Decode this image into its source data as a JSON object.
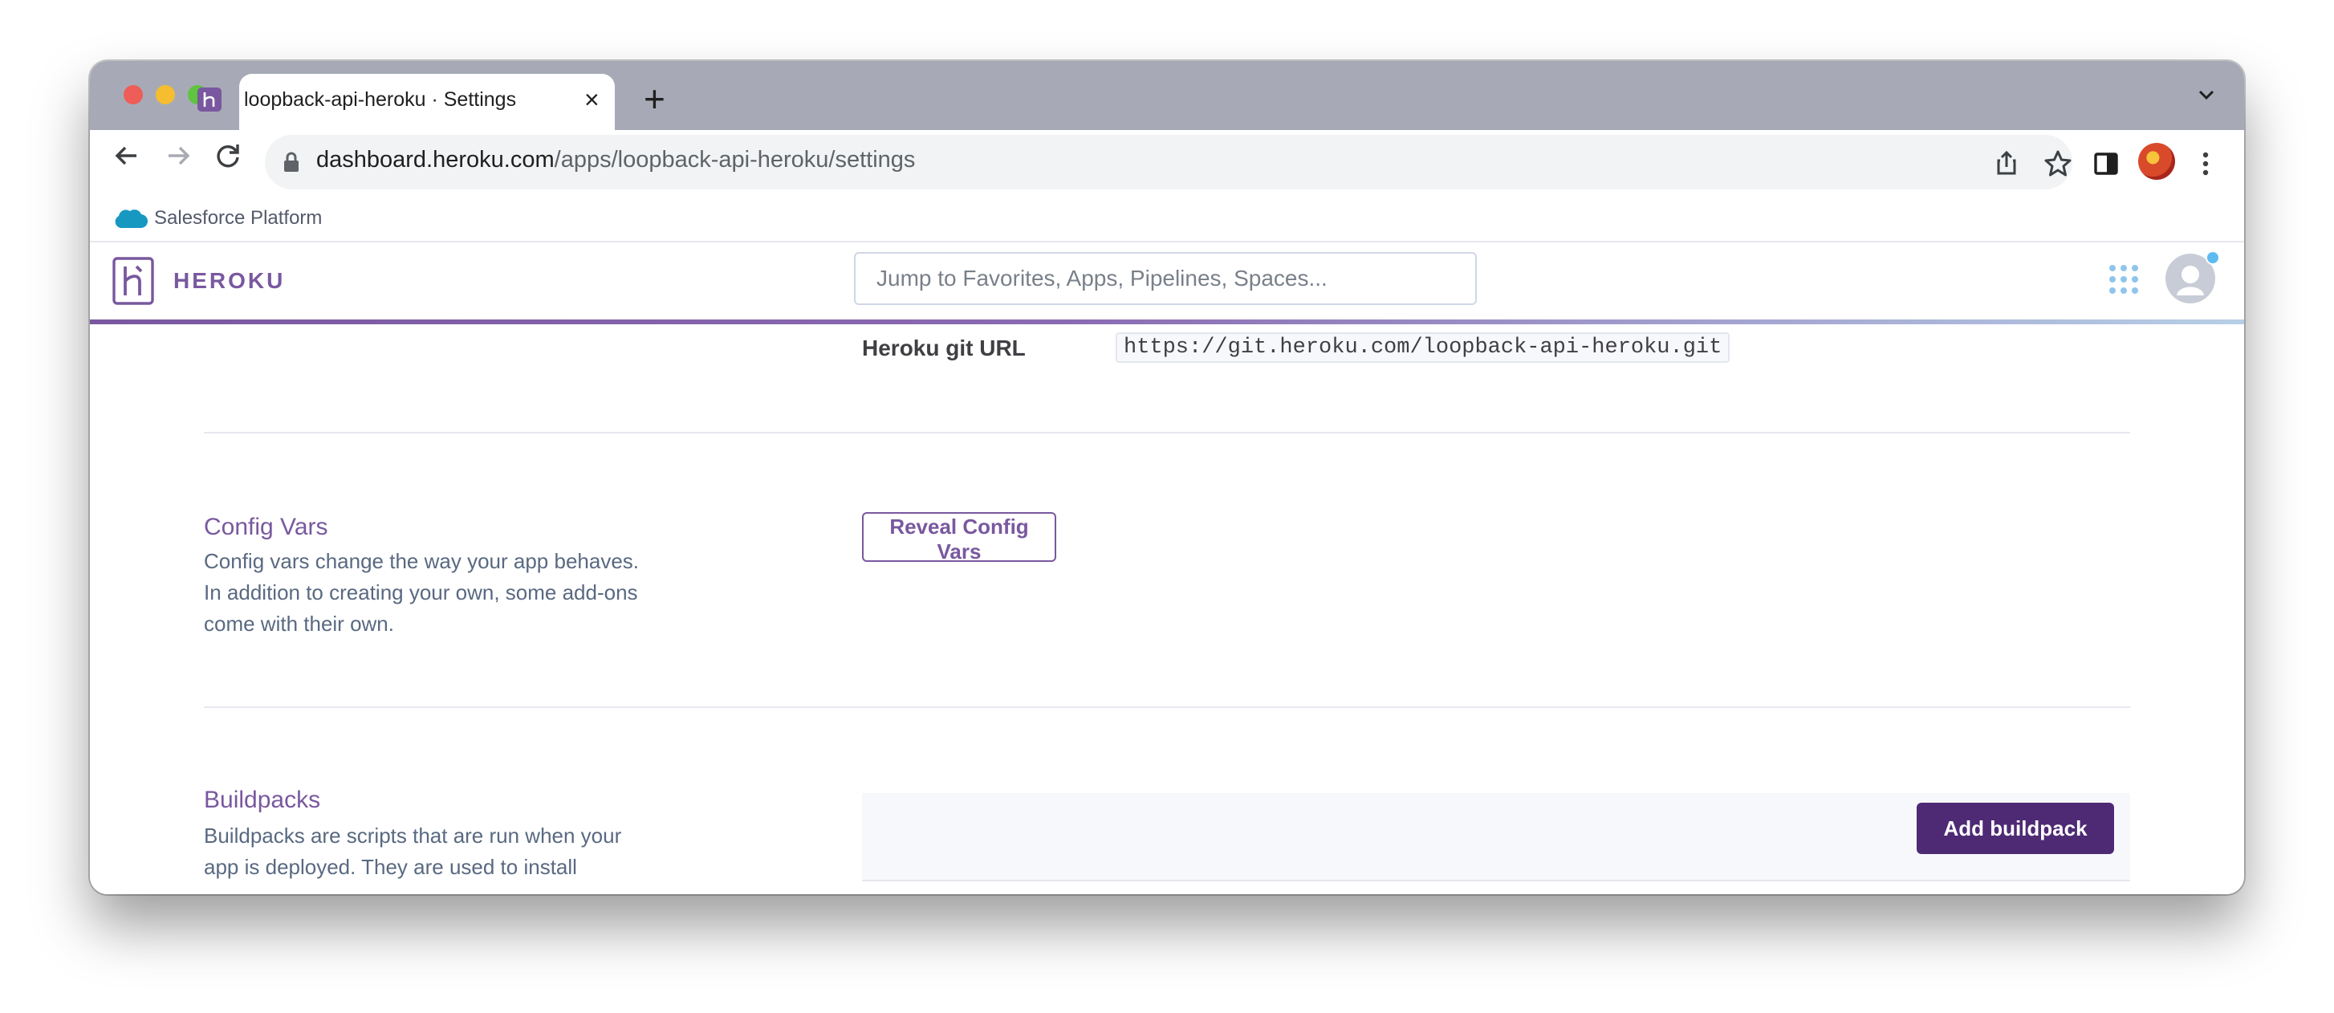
{
  "browser": {
    "tab": {
      "title": "loopback-api-heroku · Settings"
    },
    "new_tab_icon": "plus-icon",
    "url": {
      "domain": "dashboard.heroku.com",
      "path": "/apps/loopback-api-heroku/settings"
    }
  },
  "salesforce_bar": {
    "label": "Salesforce Platform"
  },
  "heroku_header": {
    "brand": "HEROKU",
    "search_placeholder": "Jump to Favorites, Apps, Pipelines, Spaces..."
  },
  "settings": {
    "git_url_label": "Heroku git URL",
    "git_url_value": "https://git.heroku.com/loopback-api-heroku.git",
    "config_vars": {
      "title": "Config Vars",
      "description": "Config vars change the way your app behaves. In addition to creating your own, some add-ons come with their own.",
      "button_label": "Reveal Config Vars"
    },
    "buildpacks": {
      "title": "Buildpacks",
      "description": "Buildpacks are scripts that are run when your app is deployed. They are used to install",
      "button_label": "Add buildpack"
    }
  },
  "colors": {
    "heroku_purple": "#79589f",
    "heroku_dark_purple": "#4e2a74",
    "tabstrip": "#a7aab6"
  }
}
